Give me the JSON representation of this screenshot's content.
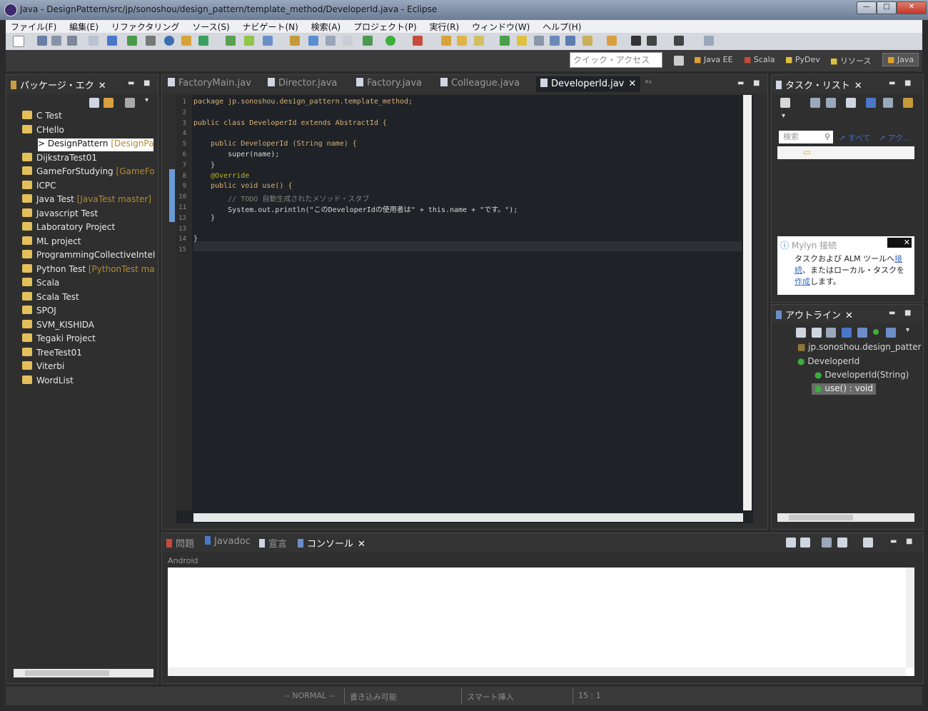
{
  "window": {
    "title": "Java - DesignPattern/src/jp/sonoshou/design_pattern/template_method/DeveloperId.java - Eclipse",
    "minimize": "—",
    "maximize": "□",
    "close": "✕"
  },
  "menu": [
    "ファイル(F)",
    "編集(E)",
    "リファクタリング",
    "ソース(S)",
    "ナビゲート(N)",
    "検索(A)",
    "プロジェクト(P)",
    "実行(R)",
    "ウィンドウ(W)",
    "ヘルプ(H)"
  ],
  "toolbar": {
    "quick_access_placeholder": "クイック・アクセス"
  },
  "perspectives": [
    "Java EE",
    "Scala",
    "PyDev",
    "リソース",
    "Java"
  ],
  "package_explorer": {
    "title": "パッケージ・エク",
    "items": [
      {
        "name": "C Test",
        "deco": ""
      },
      {
        "name": "CHello",
        "deco": ""
      },
      {
        "name": "> DesignPattern",
        "deco": "[DesignPatt"
      },
      {
        "name": "DijkstraTest01",
        "deco": ""
      },
      {
        "name": "GameForStudying",
        "deco": "[GameFor"
      },
      {
        "name": "ICPC",
        "deco": ""
      },
      {
        "name": "Java Test",
        "deco": "[JavaTest master]"
      },
      {
        "name": "Javascript Test",
        "deco": ""
      },
      {
        "name": "Laboratory Project",
        "deco": ""
      },
      {
        "name": "ML project",
        "deco": ""
      },
      {
        "name": "ProgrammingCollectiveIntelli",
        "deco": ""
      },
      {
        "name": "Python Test",
        "deco": "[PythonTest ma"
      },
      {
        "name": "Scala",
        "deco": ""
      },
      {
        "name": "Scala Test",
        "deco": ""
      },
      {
        "name": "SPOJ",
        "deco": ""
      },
      {
        "name": "SVM_KISHIDA",
        "deco": ""
      },
      {
        "name": "Tegaki Project",
        "deco": ""
      },
      {
        "name": "TreeTest01",
        "deco": ""
      },
      {
        "name": "Viterbi",
        "deco": ""
      },
      {
        "name": "WordList",
        "deco": ""
      }
    ]
  },
  "editor": {
    "tabs": [
      "FactoryMain.jav",
      "Director.java",
      "Factory.java",
      "Colleague.java",
      "DeveloperId.jav"
    ],
    "overflow": "»₅",
    "line_numbers": [
      "1",
      "2",
      "3",
      "4",
      "5",
      "6",
      "7",
      "8",
      "9",
      "10",
      "11",
      "12",
      "13",
      "14",
      "15"
    ],
    "lines": [
      "package jp.sonoshou.design_pattern.template_method;",
      "",
      "public class DeveloperId extends AbstractId {",
      "",
      "    public DeveloperId (String name) {",
      "        super(name);",
      "    }",
      "    @Override",
      "    public void use() {",
      "        // TODO 自動生成されたメソッド・スタブ",
      "        System.out.println(\"このDeveloperIdの使用者は\" + this.name + \"です。\");",
      "    }",
      "",
      "}",
      ""
    ]
  },
  "task_list": {
    "title": "タスク・リスト",
    "search_placeholder": "検索",
    "filter_all": "すべて",
    "filter_active": "アク..."
  },
  "mylyn": {
    "title": "Mylyn 接続",
    "text_1": "タスクおよび ALM ツールへ",
    "link_1": "接続",
    "text_2": "、またはローカル・タスクを",
    "link_2": "作成",
    "text_3": "します。"
  },
  "outline": {
    "title": "アウトライン",
    "items": [
      "jp.sonoshou.design_patter",
      "DeveloperId",
      "DeveloperId(String)",
      "use() : void"
    ]
  },
  "bottom": {
    "tabs": [
      "問題",
      "Javadoc",
      "宣言",
      "コンソール"
    ],
    "console_label": "Android"
  },
  "status": {
    "mode": "-- NORMAL --",
    "writable": "書き込み可能",
    "insert": "スマート挿入",
    "position": "15 : 1"
  },
  "colors": {
    "editor_bg": "#1f2226",
    "keyword": "#cc7832",
    "panel_bg": "#2f2f2f"
  }
}
